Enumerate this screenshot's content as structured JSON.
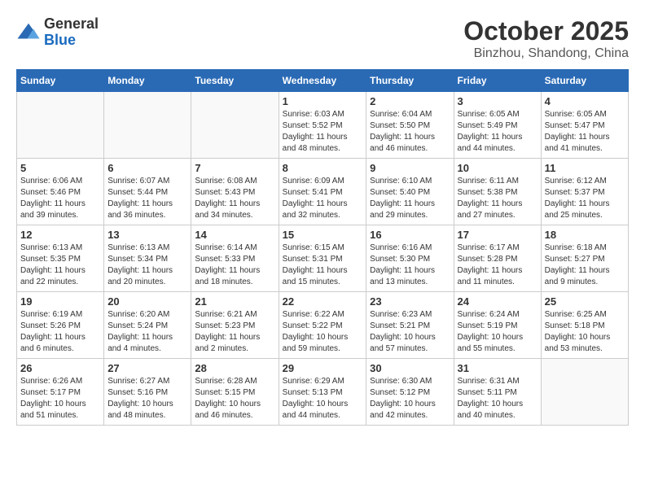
{
  "header": {
    "logo": {
      "general": "General",
      "blue": "Blue"
    },
    "title": "October 2025",
    "subtitle": "Binzhou, Shandong, China"
  },
  "weekdays": [
    "Sunday",
    "Monday",
    "Tuesday",
    "Wednesday",
    "Thursday",
    "Friday",
    "Saturday"
  ],
  "weeks": [
    [
      {
        "day": "",
        "sunrise": "",
        "sunset": "",
        "daylight": ""
      },
      {
        "day": "",
        "sunrise": "",
        "sunset": "",
        "daylight": ""
      },
      {
        "day": "",
        "sunrise": "",
        "sunset": "",
        "daylight": ""
      },
      {
        "day": "1",
        "sunrise": "Sunrise: 6:03 AM",
        "sunset": "Sunset: 5:52 PM",
        "daylight": "Daylight: 11 hours and 48 minutes."
      },
      {
        "day": "2",
        "sunrise": "Sunrise: 6:04 AM",
        "sunset": "Sunset: 5:50 PM",
        "daylight": "Daylight: 11 hours and 46 minutes."
      },
      {
        "day": "3",
        "sunrise": "Sunrise: 6:05 AM",
        "sunset": "Sunset: 5:49 PM",
        "daylight": "Daylight: 11 hours and 44 minutes."
      },
      {
        "day": "4",
        "sunrise": "Sunrise: 6:05 AM",
        "sunset": "Sunset: 5:47 PM",
        "daylight": "Daylight: 11 hours and 41 minutes."
      }
    ],
    [
      {
        "day": "5",
        "sunrise": "Sunrise: 6:06 AM",
        "sunset": "Sunset: 5:46 PM",
        "daylight": "Daylight: 11 hours and 39 minutes."
      },
      {
        "day": "6",
        "sunrise": "Sunrise: 6:07 AM",
        "sunset": "Sunset: 5:44 PM",
        "daylight": "Daylight: 11 hours and 36 minutes."
      },
      {
        "day": "7",
        "sunrise": "Sunrise: 6:08 AM",
        "sunset": "Sunset: 5:43 PM",
        "daylight": "Daylight: 11 hours and 34 minutes."
      },
      {
        "day": "8",
        "sunrise": "Sunrise: 6:09 AM",
        "sunset": "Sunset: 5:41 PM",
        "daylight": "Daylight: 11 hours and 32 minutes."
      },
      {
        "day": "9",
        "sunrise": "Sunrise: 6:10 AM",
        "sunset": "Sunset: 5:40 PM",
        "daylight": "Daylight: 11 hours and 29 minutes."
      },
      {
        "day": "10",
        "sunrise": "Sunrise: 6:11 AM",
        "sunset": "Sunset: 5:38 PM",
        "daylight": "Daylight: 11 hours and 27 minutes."
      },
      {
        "day": "11",
        "sunrise": "Sunrise: 6:12 AM",
        "sunset": "Sunset: 5:37 PM",
        "daylight": "Daylight: 11 hours and 25 minutes."
      }
    ],
    [
      {
        "day": "12",
        "sunrise": "Sunrise: 6:13 AM",
        "sunset": "Sunset: 5:35 PM",
        "daylight": "Daylight: 11 hours and 22 minutes."
      },
      {
        "day": "13",
        "sunrise": "Sunrise: 6:13 AM",
        "sunset": "Sunset: 5:34 PM",
        "daylight": "Daylight: 11 hours and 20 minutes."
      },
      {
        "day": "14",
        "sunrise": "Sunrise: 6:14 AM",
        "sunset": "Sunset: 5:33 PM",
        "daylight": "Daylight: 11 hours and 18 minutes."
      },
      {
        "day": "15",
        "sunrise": "Sunrise: 6:15 AM",
        "sunset": "Sunset: 5:31 PM",
        "daylight": "Daylight: 11 hours and 15 minutes."
      },
      {
        "day": "16",
        "sunrise": "Sunrise: 6:16 AM",
        "sunset": "Sunset: 5:30 PM",
        "daylight": "Daylight: 11 hours and 13 minutes."
      },
      {
        "day": "17",
        "sunrise": "Sunrise: 6:17 AM",
        "sunset": "Sunset: 5:28 PM",
        "daylight": "Daylight: 11 hours and 11 minutes."
      },
      {
        "day": "18",
        "sunrise": "Sunrise: 6:18 AM",
        "sunset": "Sunset: 5:27 PM",
        "daylight": "Daylight: 11 hours and 9 minutes."
      }
    ],
    [
      {
        "day": "19",
        "sunrise": "Sunrise: 6:19 AM",
        "sunset": "Sunset: 5:26 PM",
        "daylight": "Daylight: 11 hours and 6 minutes."
      },
      {
        "day": "20",
        "sunrise": "Sunrise: 6:20 AM",
        "sunset": "Sunset: 5:24 PM",
        "daylight": "Daylight: 11 hours and 4 minutes."
      },
      {
        "day": "21",
        "sunrise": "Sunrise: 6:21 AM",
        "sunset": "Sunset: 5:23 PM",
        "daylight": "Daylight: 11 hours and 2 minutes."
      },
      {
        "day": "22",
        "sunrise": "Sunrise: 6:22 AM",
        "sunset": "Sunset: 5:22 PM",
        "daylight": "Daylight: 10 hours and 59 minutes."
      },
      {
        "day": "23",
        "sunrise": "Sunrise: 6:23 AM",
        "sunset": "Sunset: 5:21 PM",
        "daylight": "Daylight: 10 hours and 57 minutes."
      },
      {
        "day": "24",
        "sunrise": "Sunrise: 6:24 AM",
        "sunset": "Sunset: 5:19 PM",
        "daylight": "Daylight: 10 hours and 55 minutes."
      },
      {
        "day": "25",
        "sunrise": "Sunrise: 6:25 AM",
        "sunset": "Sunset: 5:18 PM",
        "daylight": "Daylight: 10 hours and 53 minutes."
      }
    ],
    [
      {
        "day": "26",
        "sunrise": "Sunrise: 6:26 AM",
        "sunset": "Sunset: 5:17 PM",
        "daylight": "Daylight: 10 hours and 51 minutes."
      },
      {
        "day": "27",
        "sunrise": "Sunrise: 6:27 AM",
        "sunset": "Sunset: 5:16 PM",
        "daylight": "Daylight: 10 hours and 48 minutes."
      },
      {
        "day": "28",
        "sunrise": "Sunrise: 6:28 AM",
        "sunset": "Sunset: 5:15 PM",
        "daylight": "Daylight: 10 hours and 46 minutes."
      },
      {
        "day": "29",
        "sunrise": "Sunrise: 6:29 AM",
        "sunset": "Sunset: 5:13 PM",
        "daylight": "Daylight: 10 hours and 44 minutes."
      },
      {
        "day": "30",
        "sunrise": "Sunrise: 6:30 AM",
        "sunset": "Sunset: 5:12 PM",
        "daylight": "Daylight: 10 hours and 42 minutes."
      },
      {
        "day": "31",
        "sunrise": "Sunrise: 6:31 AM",
        "sunset": "Sunset: 5:11 PM",
        "daylight": "Daylight: 10 hours and 40 minutes."
      },
      {
        "day": "",
        "sunrise": "",
        "sunset": "",
        "daylight": ""
      }
    ]
  ]
}
